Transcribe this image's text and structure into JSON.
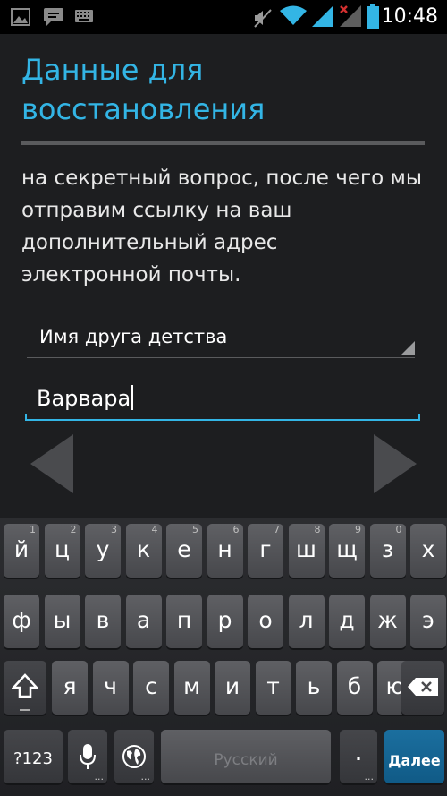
{
  "status_bar": {
    "time": "10:48",
    "icons": [
      "picture-icon",
      "chat-icon",
      "keyboard-icon",
      "mute-icon",
      "wifi-icon",
      "signal-icon",
      "no-data-signal-icon",
      "battery-icon"
    ]
  },
  "header": {
    "title": "Данные для восстановления"
  },
  "body": {
    "text": "на секретный вопрос, после чего мы отправим ссылку на ваш дополнительный адрес электронной почты."
  },
  "form": {
    "question": "Имя друга детства",
    "answer": "Варвара"
  },
  "colors": {
    "accent": "#33b5e5",
    "background": "#1d1e20",
    "key": "#55565a",
    "enter_key": "#1b6f9f"
  },
  "keyboard": {
    "row1": [
      {
        "k": "й",
        "h": "1"
      },
      {
        "k": "ц",
        "h": "2"
      },
      {
        "k": "у",
        "h": "3"
      },
      {
        "k": "к",
        "h": "4"
      },
      {
        "k": "е",
        "h": "5"
      },
      {
        "k": "н",
        "h": "6"
      },
      {
        "k": "г",
        "h": "7"
      },
      {
        "k": "ш",
        "h": "8"
      },
      {
        "k": "щ",
        "h": "9"
      },
      {
        "k": "з",
        "h": "0"
      },
      {
        "k": "х",
        "h": ""
      }
    ],
    "row2": [
      "ф",
      "ы",
      "в",
      "а",
      "п",
      "р",
      "о",
      "л",
      "д",
      "ж",
      "э"
    ],
    "row3": [
      "я",
      "ч",
      "с",
      "м",
      "и",
      "т",
      "ь",
      "б",
      "ю"
    ],
    "symbols_label": "?123",
    "space_label": "Русский",
    "period_label": ".",
    "enter_label": "Далее"
  }
}
